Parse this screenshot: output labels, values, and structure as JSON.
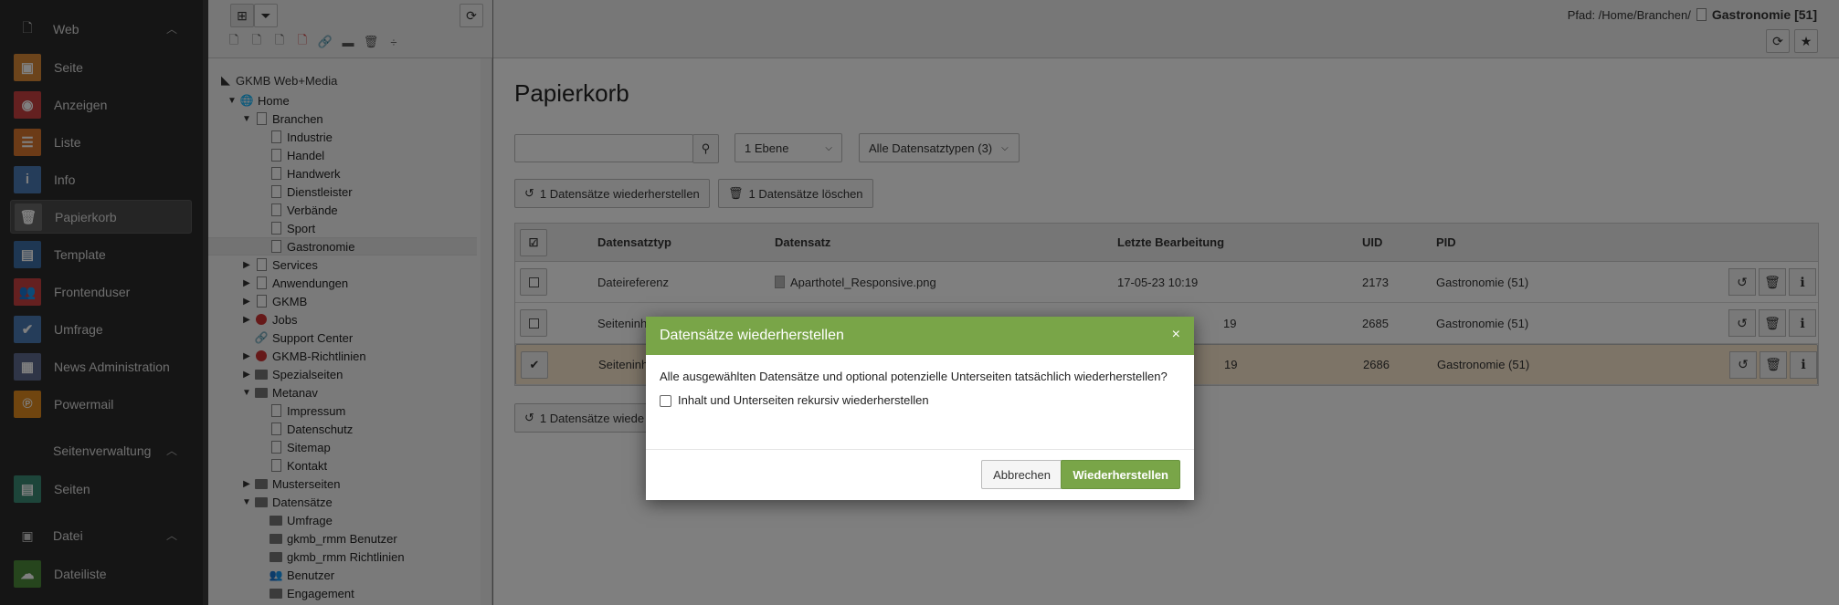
{
  "module_menu": {
    "groups": [
      {
        "label": "Web",
        "icon": "page-icon"
      },
      {
        "label": "Seitenverwaltung",
        "icon": "none"
      },
      {
        "label": "Datei",
        "icon": "image-icon"
      }
    ],
    "web_items": [
      {
        "label": "Seite",
        "icon": "page-module-icon",
        "color": "#d98836"
      },
      {
        "label": "Anzeigen",
        "icon": "eye-icon",
        "color": "#c94141"
      },
      {
        "label": "Liste",
        "icon": "list-icon",
        "color": "#d9772e"
      },
      {
        "label": "Info",
        "icon": "info-icon",
        "color": "#4b7bb5"
      },
      {
        "label": "Papierkorb",
        "icon": "trash-icon",
        "color": "#6a6a6a"
      },
      {
        "label": "Template",
        "icon": "template-icon",
        "color": "#3d6ea7"
      },
      {
        "label": "Frontenduser",
        "icon": "users-icon",
        "color": "#c94141"
      },
      {
        "label": "Umfrage",
        "icon": "check-icon",
        "color": "#4b7bb5"
      },
      {
        "label": "News Administration",
        "icon": "news-icon",
        "color": "#5e6b8f"
      },
      {
        "label": "Powermail",
        "icon": "powermail-icon",
        "color": "#e08a1e"
      }
    ],
    "seiten_items": [
      {
        "label": "Seiten",
        "icon": "pages-icon",
        "color": "#3a8a74"
      }
    ],
    "datei_items": [
      {
        "label": "Dateiliste",
        "icon": "filelist-icon",
        "color": "#4d8a3a"
      }
    ]
  },
  "tree": {
    "root": "GKMB Web+Media",
    "nodes": [
      {
        "label": "Home",
        "level": 1,
        "toggle": "▼",
        "type": "globe"
      },
      {
        "label": "Branchen",
        "level": 2,
        "toggle": "▼",
        "type": "page"
      },
      {
        "label": "Industrie",
        "level": 3,
        "toggle": "",
        "type": "page"
      },
      {
        "label": "Handel",
        "level": 3,
        "toggle": "",
        "type": "page"
      },
      {
        "label": "Handwerk",
        "level": 3,
        "toggle": "",
        "type": "page"
      },
      {
        "label": "Dienstleister",
        "level": 3,
        "toggle": "",
        "type": "page"
      },
      {
        "label": "Verbände",
        "level": 3,
        "toggle": "",
        "type": "page"
      },
      {
        "label": "Sport",
        "level": 3,
        "toggle": "",
        "type": "page"
      },
      {
        "label": "Gastronomie",
        "level": 3,
        "toggle": "",
        "type": "page"
      },
      {
        "label": "Services",
        "level": 2,
        "toggle": "▶",
        "type": "page"
      },
      {
        "label": "Anwendungen",
        "level": 2,
        "toggle": "▶",
        "type": "page"
      },
      {
        "label": "GKMB",
        "level": 2,
        "toggle": "▶",
        "type": "page"
      },
      {
        "label": "Jobs",
        "level": 2,
        "toggle": "▶",
        "type": "restricted"
      },
      {
        "label": "Support Center",
        "level": 2,
        "toggle": "",
        "type": "link"
      },
      {
        "label": "GKMB-Richtlinien",
        "level": 2,
        "toggle": "▶",
        "type": "restricted"
      },
      {
        "label": "Spezialseiten",
        "level": 2,
        "toggle": "▶",
        "type": "folder"
      },
      {
        "label": "Metanav",
        "level": 2,
        "toggle": "▼",
        "type": "folder"
      },
      {
        "label": "Impressum",
        "level": 3,
        "toggle": "",
        "type": "page"
      },
      {
        "label": "Datenschutz",
        "level": 3,
        "toggle": "",
        "type": "page"
      },
      {
        "label": "Sitemap",
        "level": 3,
        "toggle": "",
        "type": "page"
      },
      {
        "label": "Kontakt",
        "level": 3,
        "toggle": "",
        "type": "page"
      },
      {
        "label": "Musterseiten",
        "level": 2,
        "toggle": "▶",
        "type": "folder"
      },
      {
        "label": "Datensätze",
        "level": 2,
        "toggle": "▼",
        "type": "folder"
      },
      {
        "label": "Umfrage",
        "level": 3,
        "toggle": "",
        "type": "folder"
      },
      {
        "label": "gkmb_rmm Benutzer",
        "level": 3,
        "toggle": "",
        "type": "folder"
      },
      {
        "label": "gkmb_rmm Richtlinien",
        "level": 3,
        "toggle": "",
        "type": "folder"
      },
      {
        "label": "Benutzer",
        "level": 3,
        "toggle": "",
        "type": "users"
      },
      {
        "label": "Engagement",
        "level": 3,
        "toggle": "",
        "type": "folder"
      }
    ]
  },
  "path": {
    "label": "Pfad: /Home/Branchen/",
    "title": "Gastronomie [51]"
  },
  "content": {
    "title": "Papierkorb",
    "search_placeholder": "",
    "depth_select": "1 Ebene",
    "type_select": "Alle Datensatztypen (3)",
    "restore_button": "1 Datensätze wiederherstellen",
    "delete_button": "1 Datensätze löschen",
    "restore_button_bottom": "1 Datensätze wiede"
  },
  "table": {
    "headers": [
      "Datensatztyp",
      "Datensatz",
      "Letzte Bearbeitung",
      "UID",
      "PID"
    ],
    "rows": [
      {
        "type": "Dateireferenz",
        "record": "Aparthotel_Responsive.png",
        "date": "17-05-23 10:19",
        "uid": "2173",
        "pid": "Gastronomie (51)",
        "checked": false
      },
      {
        "type": "Seiteninh",
        "record": "",
        "date": "19",
        "uid": "2685",
        "pid": "Gastronomie (51)",
        "checked": false
      },
      {
        "type": "Seiteninh",
        "record": "",
        "date": "19",
        "uid": "2686",
        "pid": "Gastronomie (51)",
        "checked": true
      }
    ]
  },
  "modal": {
    "title": "Datensätze wiederherstellen",
    "close": "×",
    "message": "Alle ausgewählten Datensätze und optional potenzielle Unterseiten tatsächlich wiederherstellen?",
    "checkbox_label": "Inhalt und Unterseiten rekursiv wiederherstellen",
    "cancel": "Abbrechen",
    "confirm": "Wiederherstellen"
  },
  "colors": {
    "modal_header": "#79a548",
    "selected_row": "#fbe9cf",
    "sidebar_bg": "#2b2b2b"
  }
}
